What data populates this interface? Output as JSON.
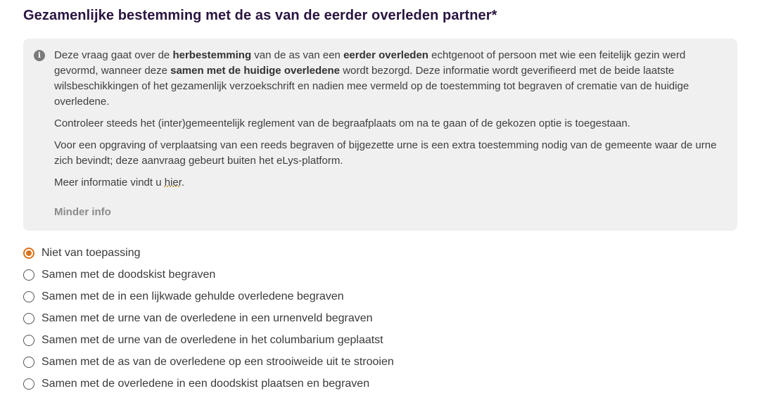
{
  "title": "Gezamenlijke bestemming met de as van de eerder overleden partner*",
  "info": {
    "icon": "info-icon",
    "p1": {
      "t1": "Deze vraag gaat over de ",
      "b1": "herbestemming",
      "t2": " van de as van een ",
      "b2": "eerder overleden",
      "t3": " echtgenoot of persoon met wie een feitelijk gezin werd gevormd, wanneer deze ",
      "b3": "samen met de huidige overledene",
      "t4": " wordt bezorgd. Deze informatie wordt geverifieerd met de beide laatste wilsbeschikkingen of het gezamenlijk verzoekschrift en nadien mee vermeld op de toestemming tot begraven of crematie van de huidige overledene."
    },
    "p2": "Controleer steeds het (inter)gemeentelijk reglement van de begraafplaats om na te gaan of de gekozen optie is toegestaan.",
    "p3": "Voor een opgraving of verplaatsing van een reeds begraven of bijgezette urne is een extra toestemming nodig van de gemeente waar de urne zich bevindt; deze aanvraag gebeurt buiten het eLys-platform.",
    "p4": {
      "t1": "Meer informatie vindt u ",
      "link": "hier",
      "t2": "."
    },
    "less_info": "Minder info"
  },
  "options": [
    {
      "label": "Niet van toepassing",
      "selected": true
    },
    {
      "label": "Samen met de doodskist begraven",
      "selected": false
    },
    {
      "label": "Samen met de in een lijkwade gehulde overledene begraven",
      "selected": false
    },
    {
      "label": "Samen met de urne van de overledene in een urnenveld begraven",
      "selected": false
    },
    {
      "label": "Samen met de urne van de overledene in het columbarium geplaatst",
      "selected": false
    },
    {
      "label": "Samen met de as van de overledene op een strooiweide uit te strooien",
      "selected": false
    },
    {
      "label": "Samen met de overledene in een doodskist plaatsen en begraven",
      "selected": false
    }
  ],
  "colors": {
    "accent": "#d9731c",
    "title": "#2a1540",
    "infobox_bg": "#f0f0f0"
  }
}
